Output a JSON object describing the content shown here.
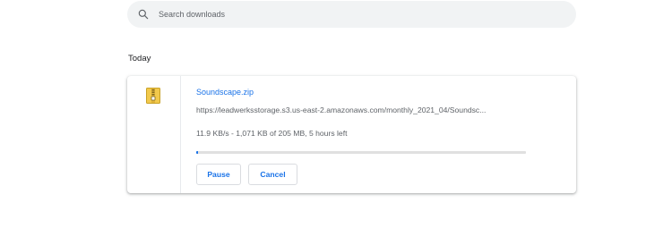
{
  "search": {
    "placeholder": "Search downloads",
    "icon": "search-icon"
  },
  "section": {
    "label": "Today"
  },
  "download": {
    "icon": "zip-file-icon",
    "file_name": "Soundscape.zip",
    "url": "https://leadwerksstorage.s3.us-east-2.amazonaws.com/monthly_2021_04/Soundsc...",
    "status": "11.9 KB/s - 1,071 KB of 205 MB, 5 hours left",
    "progress_fraction": 0.005,
    "pause_label": "Pause",
    "cancel_label": "Cancel"
  },
  "colors": {
    "accent": "#1a73e8",
    "search_bg": "#f1f3f4",
    "secondary_text": "#5f6368"
  }
}
